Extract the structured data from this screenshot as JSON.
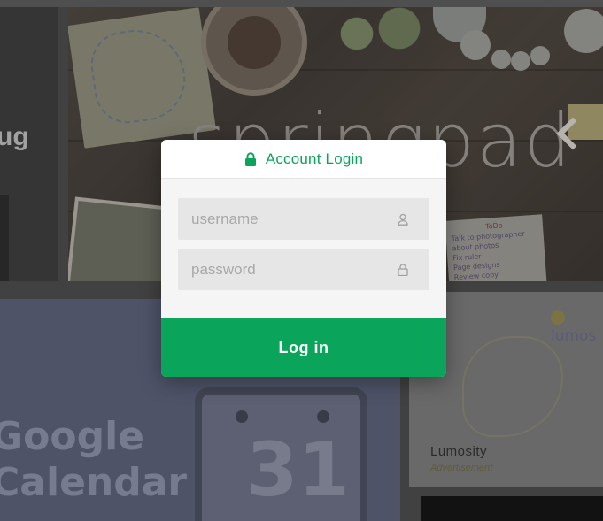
{
  "background": {
    "left_brand_fragment": "ug",
    "springpad": {
      "wordmark": "springpad",
      "todo_note": [
        "ToDo",
        "Talk to photographer",
        "about photos",
        "Fix ruler",
        "Page designs",
        "Review copy"
      ]
    },
    "google_calendar": {
      "title_line1": "Google",
      "title_line2": "Calendar",
      "date": "31"
    },
    "lumosity": {
      "logo_text": "lumos",
      "name": "Lumosity",
      "ad_label": "Advertisement"
    }
  },
  "login": {
    "title": "Account Login",
    "username_placeholder": "username",
    "password_placeholder": "password",
    "submit_label": "Log in",
    "icons": {
      "title": "lock-icon",
      "username": "user-icon",
      "password": "lock-icon"
    },
    "colors": {
      "accent": "#0aa55a",
      "field_bg": "#e6e6e6",
      "panel_bg": "#f5f5f5"
    }
  }
}
